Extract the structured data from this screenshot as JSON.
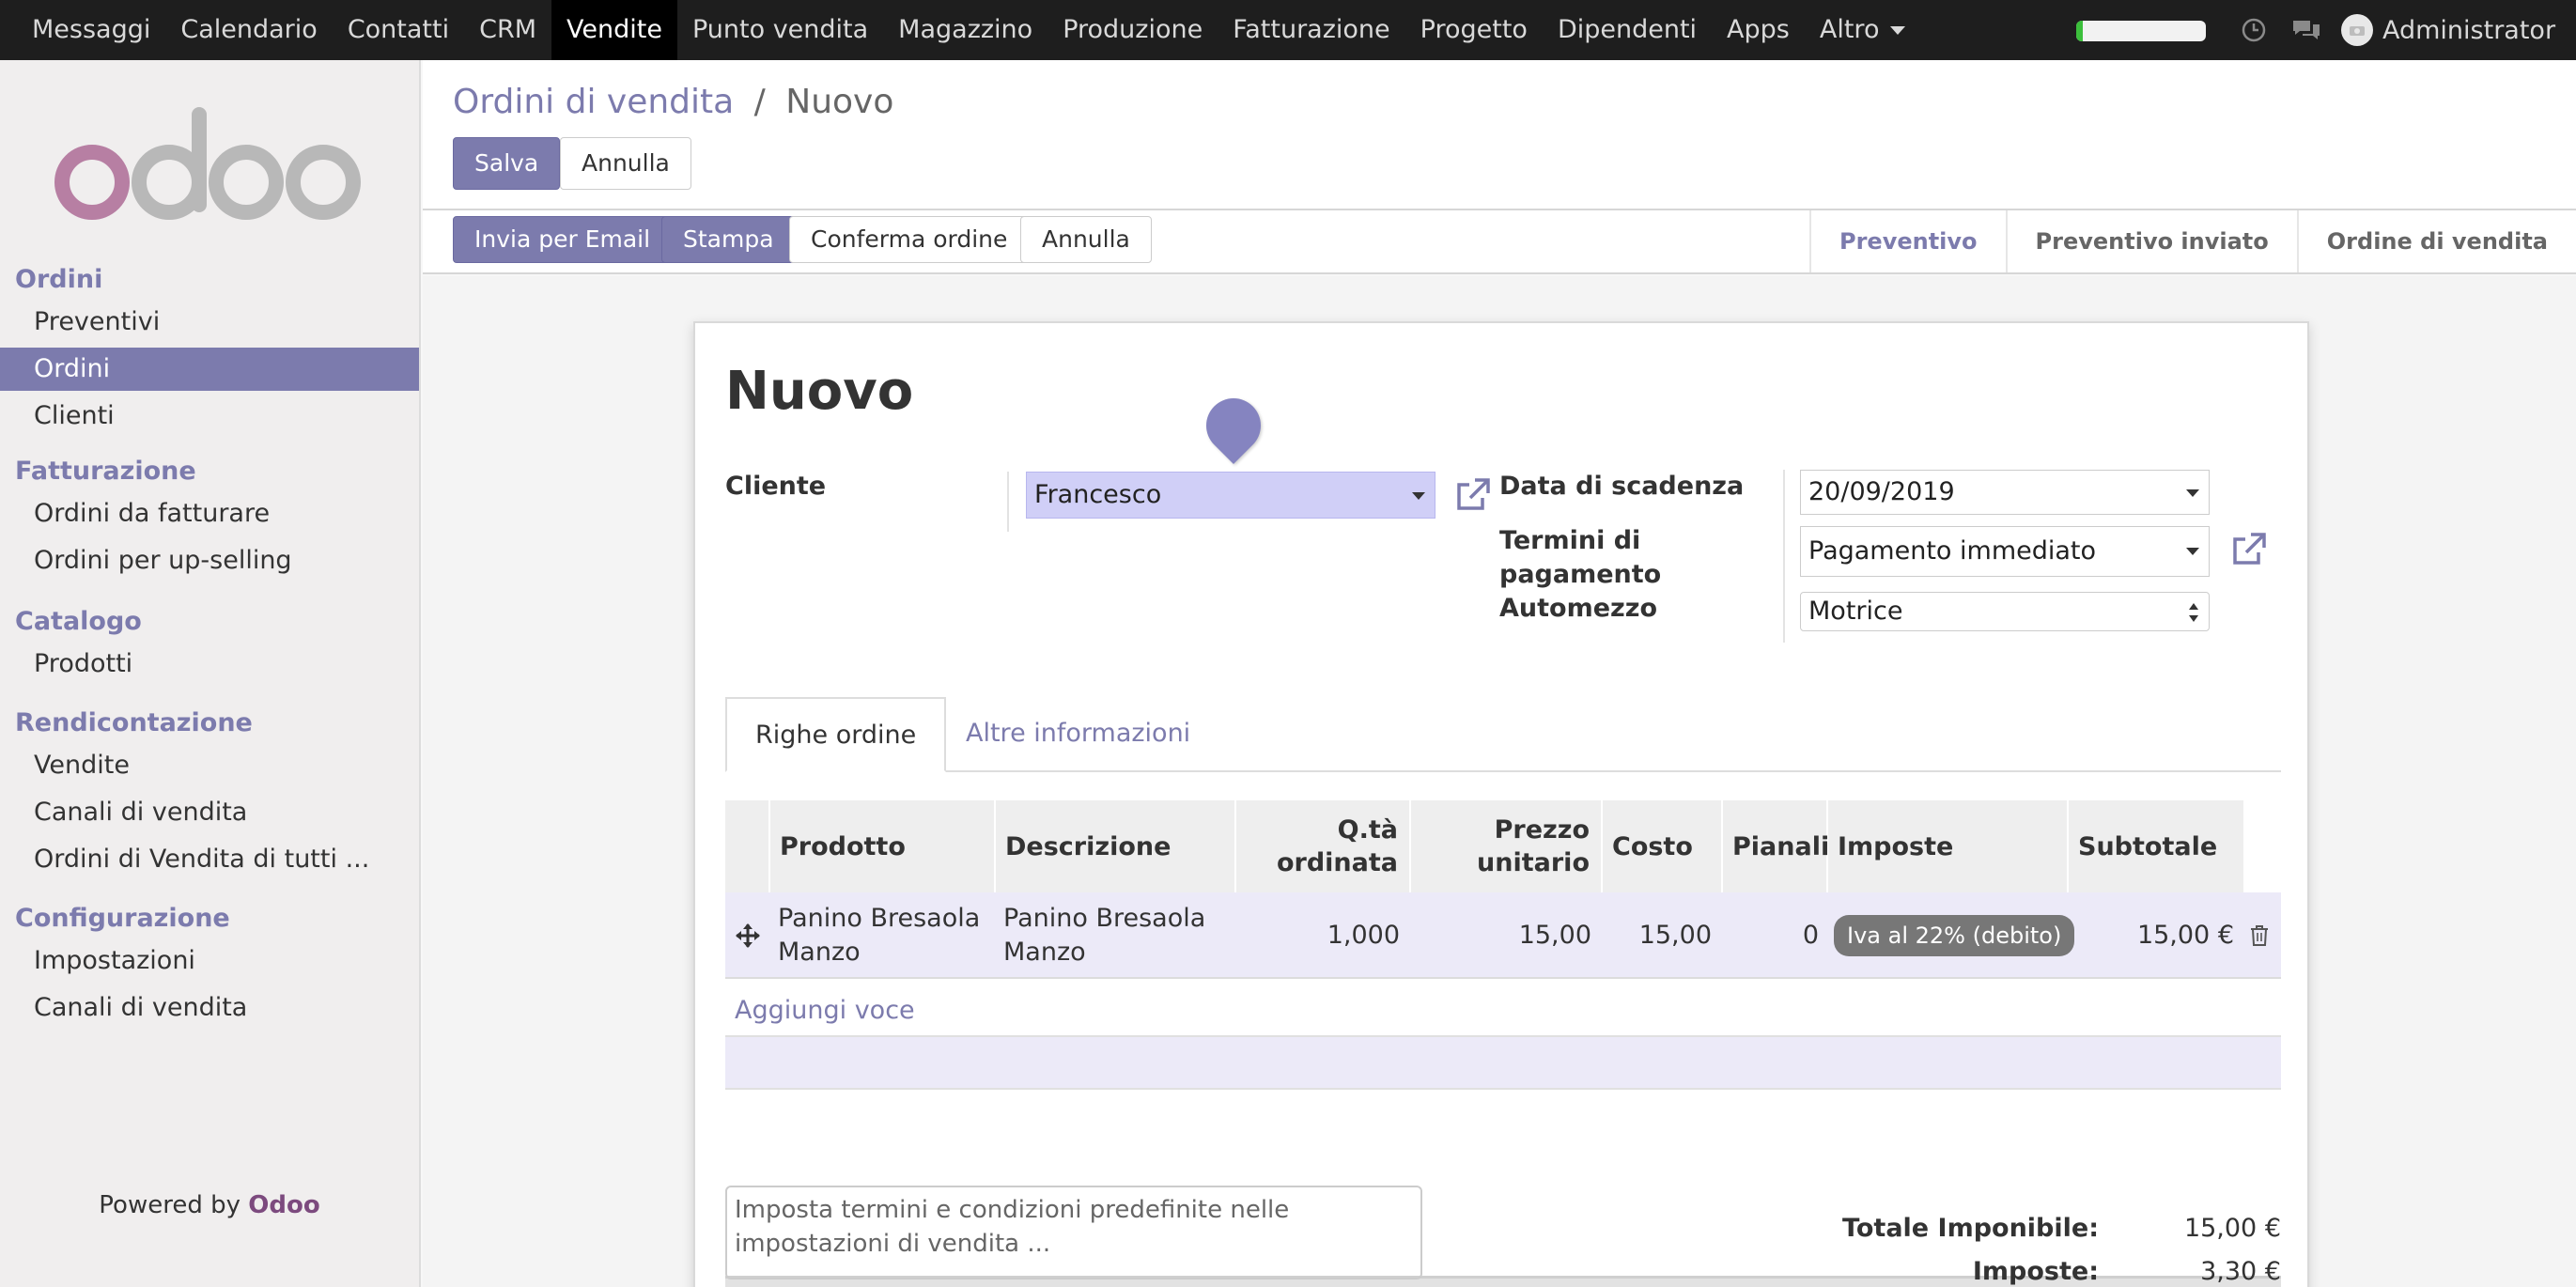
{
  "topbar": {
    "menu": [
      "Messaggi",
      "Calendario",
      "Contatti",
      "CRM",
      "Vendite",
      "Punto vendita",
      "Magazzino",
      "Produzione",
      "Fatturazione",
      "Progetto",
      "Dipendenti",
      "Apps",
      "Altro"
    ],
    "active_index": 4,
    "progress_fraction": 0.05,
    "user_name": "Administrator"
  },
  "sidebar": {
    "logo_text": "odoo",
    "sections": [
      {
        "title": "Ordini",
        "items": [
          "Preventivi",
          "Ordini",
          "Clienti"
        ]
      },
      {
        "title": "Fatturazione",
        "items": [
          "Ordini da fatturare",
          "Ordini per up-selling"
        ]
      },
      {
        "title": "Catalogo",
        "items": [
          "Prodotti"
        ]
      },
      {
        "title": "Rendicontazione",
        "items": [
          "Vendite",
          "Canali di vendita",
          "Ordini di Vendita di tutti ..."
        ]
      },
      {
        "title": "Configurazione",
        "items": [
          "Impostazioni",
          "Canali di vendita"
        ]
      }
    ],
    "active_item": "Ordini",
    "powered_prefix": "Powered by ",
    "powered_brand": "Odoo"
  },
  "breadcrumb": {
    "parent": "Ordini di vendita",
    "separator": "/",
    "current": "Nuovo"
  },
  "actions": {
    "save": "Salva",
    "discard": "Annulla"
  },
  "header_buttons": {
    "email": "Invia per Email",
    "print": "Stampa",
    "confirm": "Conferma ordine",
    "cancel": "Annulla"
  },
  "statusbar": {
    "steps": [
      "Preventivo",
      "Preventivo inviato",
      "Ordine di vendita"
    ],
    "current": "Preventivo"
  },
  "form": {
    "title": "Nuovo",
    "customer_label": "Cliente",
    "customer_value": "Francesco",
    "due_date_label": "Data di scadenza",
    "due_date_value": "20/09/2019",
    "payment_terms_label_1": "Termini di",
    "payment_terms_label_2": "pagamento",
    "payment_terms_value": "Pagamento immediato",
    "vehicle_label": "Automezzo",
    "vehicle_value": "Motrice"
  },
  "tabs": [
    "Righe ordine",
    "Altre informazioni"
  ],
  "order_lines": {
    "headers": {
      "product": "Prodotto",
      "description": "Descrizione",
      "qty_1": "Q.tà",
      "qty_2": "ordinata",
      "price_1": "Prezzo",
      "price_2": "unitario",
      "cost": "Costo",
      "pianali": "Pianali",
      "taxes": "Imposte",
      "subtotal": "Subtotale"
    },
    "rows": [
      {
        "product_1": "Panino Bresaola",
        "product_2": "Manzo",
        "description_1": "Panino Bresaola",
        "description_2": "Manzo",
        "qty": "1,000",
        "price": "15,00",
        "cost": "15,00",
        "pianali": "0",
        "tax": "Iva al 22% (debito)",
        "subtotal": "15,00 €"
      }
    ],
    "add_line": "Aggiungi voce"
  },
  "footer": {
    "terms_placeholder": "Imposta termini e condizioni predefinite nelle impostazioni di vendita ...",
    "untaxed_label": "Totale Imponibile:",
    "untaxed_value": "15,00 €",
    "taxes_label": "Imposte:",
    "taxes_value": "3,30 €"
  },
  "colors": {
    "accent": "#7c7bad",
    "topbar": "#1e1e1e",
    "highlight": "#d0cff7"
  }
}
